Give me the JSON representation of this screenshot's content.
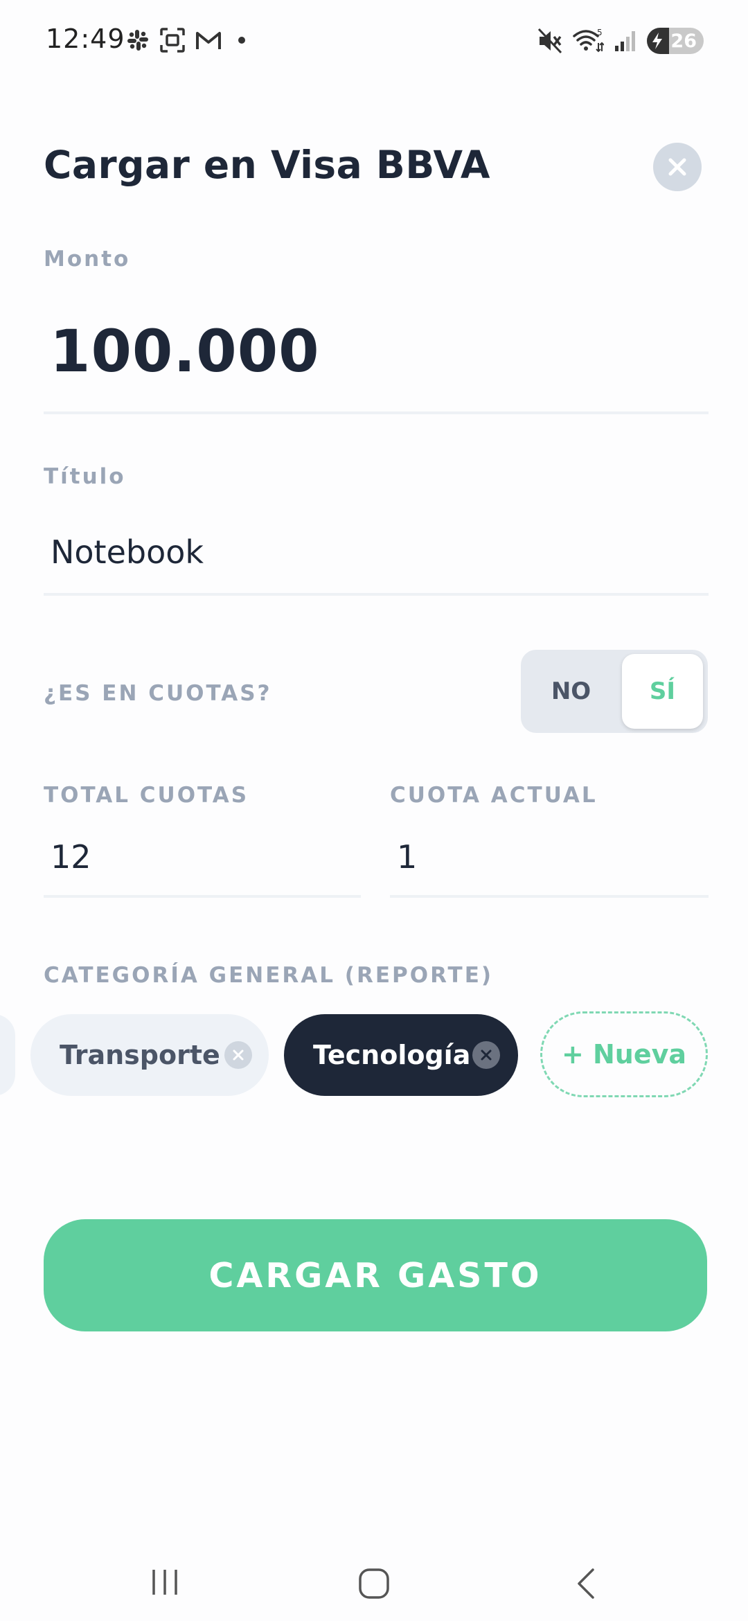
{
  "status_bar": {
    "time": "12:49",
    "notification_icons": [
      "slack-icon",
      "screenshot-icon",
      "gmail-icon",
      "dot-icon"
    ],
    "system_icons": [
      "mute-icon",
      "wifi-icon",
      "signal-icon",
      "battery-icon"
    ],
    "battery_level": "26"
  },
  "header": {
    "title": "Cargar en Visa BBVA",
    "close_icon": "close-icon"
  },
  "form": {
    "amount_label": "Monto",
    "amount_value": "100.000",
    "title_label": "Título",
    "title_value": "Notebook",
    "installments_question": "¿ES EN CUOTAS?",
    "toggle_no": "NO",
    "toggle_yes": "SÍ",
    "toggle_selected": "SÍ",
    "total_installments_label": "TOTAL CUOTAS",
    "total_installments_value": "12",
    "current_installment_label": "CUOTA ACTUAL",
    "current_installment_value": "1",
    "category_label": "CATEGORÍA GENERAL (REPORTE)",
    "categories": [
      {
        "label": "Transporte",
        "selected": false
      },
      {
        "label": "Tecnología",
        "selected": true
      }
    ],
    "new_category_label": "+ Nueva",
    "submit_label": "CARGAR GASTO"
  },
  "colors": {
    "accent": "#5fcf9e",
    "dark": "#1e2738",
    "label": "#9aa5b6"
  },
  "nav_bar": {
    "icons": [
      "recents-icon",
      "home-icon",
      "back-icon"
    ]
  }
}
